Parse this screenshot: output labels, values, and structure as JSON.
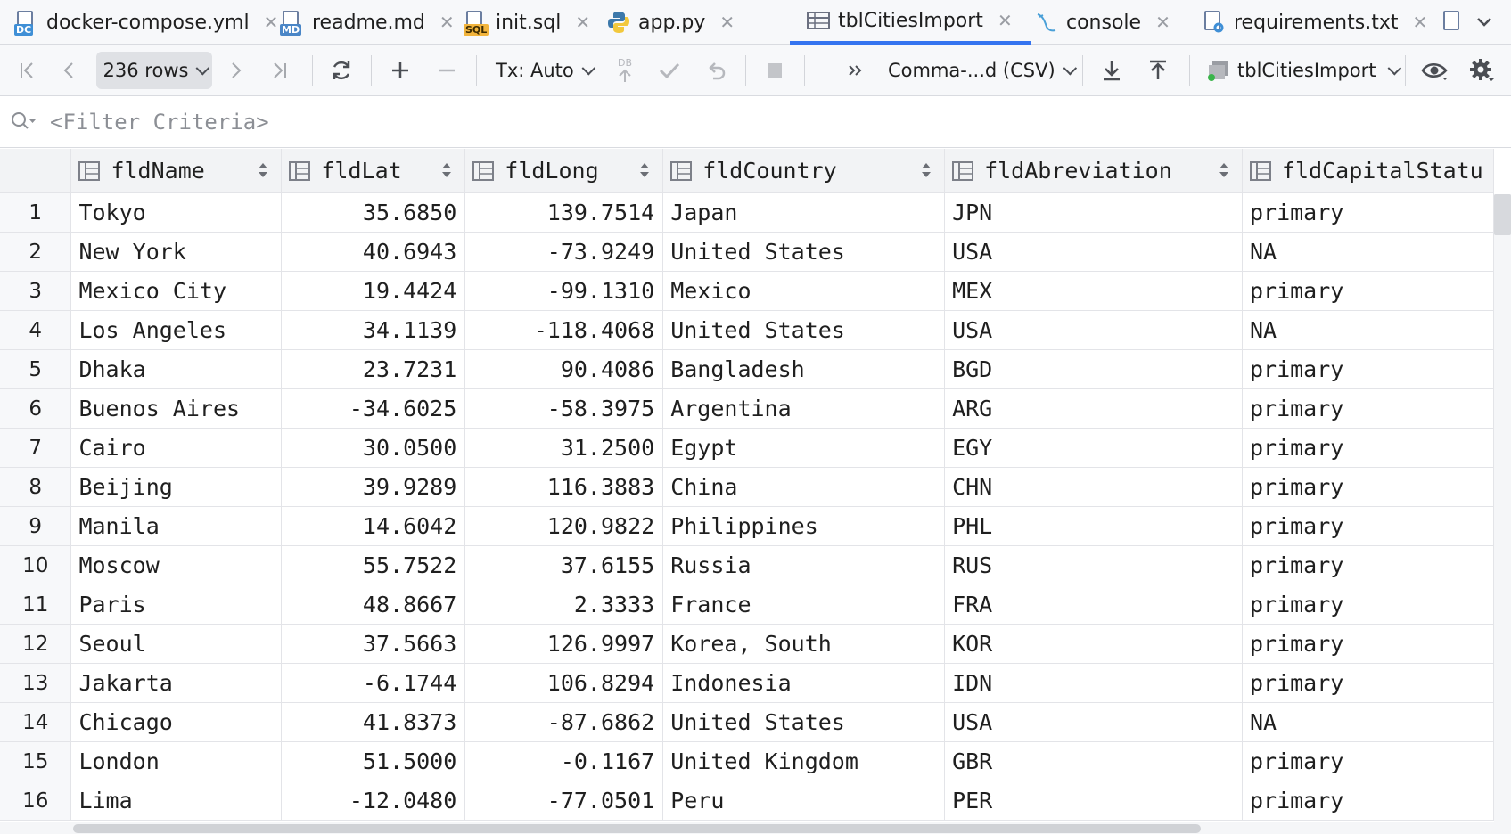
{
  "tabs": [
    {
      "label": "docker-compose.yml",
      "icon": "docker-compose-file-icon",
      "badge": "DC",
      "active": false
    },
    {
      "label": "readme.md",
      "icon": "markdown-file-icon",
      "badge": "MD",
      "active": false
    },
    {
      "label": "init.sql",
      "icon": "sql-file-icon",
      "badge": "SQL",
      "active": false
    },
    {
      "label": "app.py",
      "icon": "python-file-icon",
      "badge": "",
      "active": false
    },
    {
      "label": "tblCitiesImport",
      "icon": "table-icon",
      "badge": "",
      "active": true
    },
    {
      "label": "console",
      "icon": "console-icon",
      "badge": "",
      "active": false
    },
    {
      "label": "requirements.txt",
      "icon": "requirements-file-icon",
      "badge": "",
      "active": false
    }
  ],
  "toolbar": {
    "rows_label": "236 rows",
    "tx_label": "Tx: Auto",
    "db_label": "DB",
    "export_format": "Comma-...d (CSV)",
    "datasource": "tblCitiesImport"
  },
  "filter": {
    "placeholder": "<Filter Criteria>"
  },
  "table": {
    "columns": [
      "fldName",
      "fldLat",
      "fldLong",
      "fldCountry",
      "fldAbreviation",
      "fldCapitalStatu"
    ],
    "rows": [
      [
        "1",
        "Tokyo",
        "35.6850",
        "139.7514",
        "Japan",
        "JPN",
        "primary"
      ],
      [
        "2",
        "New York",
        "40.6943",
        "-73.9249",
        "United States",
        "USA",
        "NA"
      ],
      [
        "3",
        "Mexico City",
        "19.4424",
        "-99.1310",
        "Mexico",
        "MEX",
        "primary"
      ],
      [
        "4",
        "Los Angeles",
        "34.1139",
        "-118.4068",
        "United States",
        "USA",
        "NA"
      ],
      [
        "5",
        "Dhaka",
        "23.7231",
        "90.4086",
        "Bangladesh",
        "BGD",
        "primary"
      ],
      [
        "6",
        "Buenos Aires",
        "-34.6025",
        "-58.3975",
        "Argentina",
        "ARG",
        "primary"
      ],
      [
        "7",
        "Cairo",
        "30.0500",
        "31.2500",
        "Egypt",
        "EGY",
        "primary"
      ],
      [
        "8",
        "Beijing",
        "39.9289",
        "116.3883",
        "China",
        "CHN",
        "primary"
      ],
      [
        "9",
        "Manila",
        "14.6042",
        "120.9822",
        "Philippines",
        "PHL",
        "primary"
      ],
      [
        "10",
        "Moscow",
        "55.7522",
        "37.6155",
        "Russia",
        "RUS",
        "primary"
      ],
      [
        "11",
        "Paris",
        "48.8667",
        "2.3333",
        "France",
        "FRA",
        "primary"
      ],
      [
        "12",
        "Seoul",
        "37.5663",
        "126.9997",
        "Korea, South",
        "KOR",
        "primary"
      ],
      [
        "13",
        "Jakarta",
        "-6.1744",
        "106.8294",
        "Indonesia",
        "IDN",
        "primary"
      ],
      [
        "14",
        "Chicago",
        "41.8373",
        "-87.6862",
        "United States",
        "USA",
        "NA"
      ],
      [
        "15",
        "London",
        "51.5000",
        "-0.1167",
        "United Kingdom",
        "GBR",
        "primary"
      ],
      [
        "16",
        "Lima",
        "-12.0480",
        "-77.0501",
        "Peru",
        "PER",
        "primary"
      ]
    ]
  },
  "colors": {
    "accent": "#3574f0",
    "header_bg": "#f2f3f5",
    "toolbar_bg": "#f7f8fa"
  }
}
